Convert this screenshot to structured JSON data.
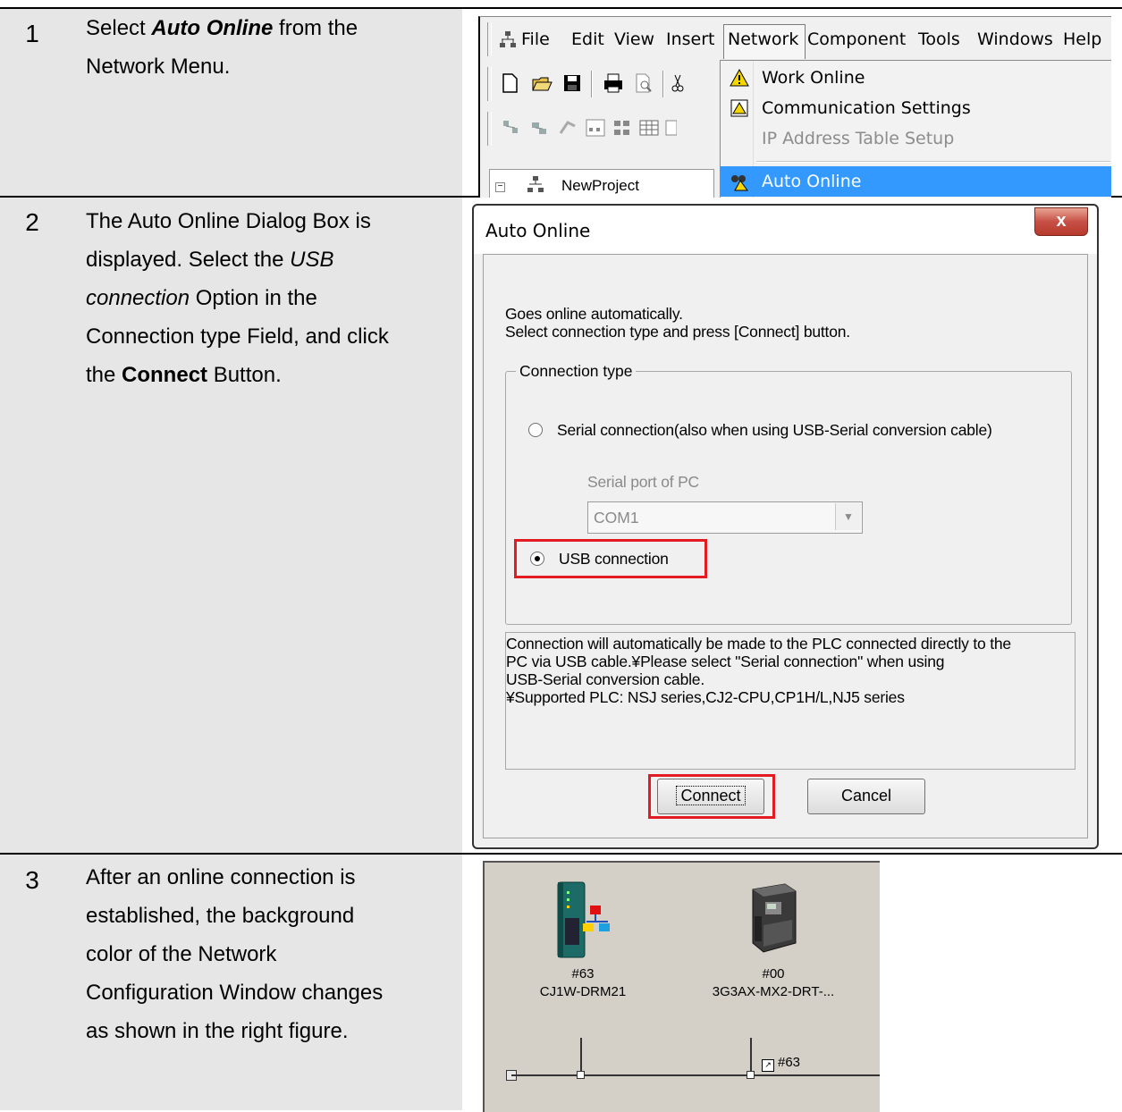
{
  "steps": [
    {
      "num": "1",
      "text_a": "Select ",
      "text_b": "Auto Online",
      "text_c": " from the Network Menu."
    },
    {
      "num": "2",
      "line1": "The Auto Online Dialog Box is",
      "line2": "displayed. Select the ",
      "line2_i": "USB",
      "line3_i": "connection",
      "line3": " Option in the",
      "line4": "Connection type Field, and click",
      "line5_a": "the ",
      "line5_b": "Connect",
      "line5_c": " Button."
    },
    {
      "num": "3",
      "line1": "After an online connection is",
      "line2": "established, the background",
      "line3": "color of the Network",
      "line4": "Configuration Window changes",
      "line5": "as shown in the right figure."
    }
  ],
  "menu": {
    "items": [
      "File",
      "Edit",
      "View",
      "Insert",
      "Network",
      "Component",
      "Tools",
      "Windows",
      "Help"
    ],
    "dropdown": [
      {
        "label": "Work Online",
        "icon": "warning-icon",
        "enabled": true
      },
      {
        "label": "Communication Settings",
        "icon": "comm-settings-icon",
        "enabled": true
      },
      {
        "label": "IP Address Table Setup",
        "icon": "",
        "enabled": false
      },
      {
        "label": "Auto Online",
        "icon": "auto-online-icon",
        "enabled": true,
        "highlighted": true
      }
    ],
    "tree_item": "NewProject"
  },
  "dialog": {
    "title": "Auto Online",
    "close": "x",
    "intro1": "Goes online automatically.",
    "intro2": "Select connection type and press [Connect] button.",
    "group_label": "Connection type",
    "serial_option": "Serial connection(also when using USB-Serial conversion cable)",
    "serial_port_label": "Serial port of PC",
    "serial_port_value": "COM1",
    "usb_option": "USB connection",
    "info1": "Connection will automatically be made to the PLC connected directly to the",
    "info2": "PC via USB cable.¥Please select \"Serial connection\" when using",
    "info3": "USB-Serial conversion cable.",
    "info4": "¥Supported PLC: NSJ series,CJ2-CPU,CP1H/L,NJ5 series",
    "connect": "Connect",
    "cancel": "Cancel"
  },
  "network": {
    "nodes": [
      {
        "addr": "#63",
        "name": "CJ1W-DRM21"
      },
      {
        "addr": "#00",
        "name": "3G3AX-MX2-DRT-..."
      }
    ],
    "link_label": "#63"
  },
  "colors": {
    "highlight_red": "#e31b23",
    "menu_select_blue": "#3399ff",
    "step_bg": "#e6e6e6"
  }
}
